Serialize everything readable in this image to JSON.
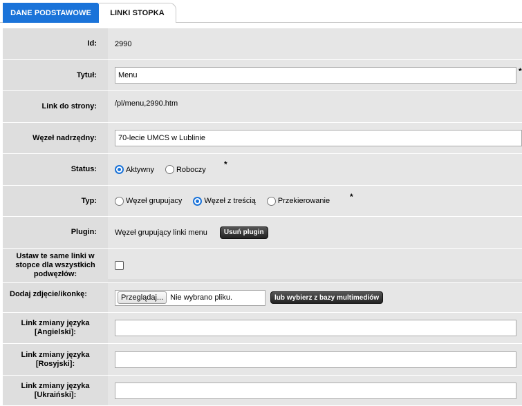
{
  "tabs": {
    "basic": "DANE PODSTAWOWE",
    "footer_links": "LINKI STOPKA"
  },
  "fields": {
    "id": {
      "label": "Id:",
      "value": "2990"
    },
    "title": {
      "label": "Tytuł:",
      "value": "Menu",
      "required": "*"
    },
    "page_link": {
      "label": "Link do strony:",
      "value": "/pl/menu,2990.htm"
    },
    "parent_node": {
      "label": "Węzeł nadrzędny:",
      "value": "70-lecie UMCS w Lublinie"
    },
    "status": {
      "label": "Status:",
      "options": [
        "Aktywny",
        "Roboczy"
      ],
      "selected": "Aktywny",
      "required": "*"
    },
    "type": {
      "label": "Typ:",
      "options": [
        "Węzeł grupujacy",
        "Węzeł z treścią",
        "Przekierowanie"
      ],
      "selected": "Węzeł z treścią",
      "required": "*"
    },
    "plugin": {
      "label": "Plugin:",
      "value": "Węzeł grupujący linki menu",
      "remove_button": "Usuń plugin"
    },
    "same_footer": {
      "label": "Ustaw te same linki w stopce dla wszystkich podwęzłów:",
      "checked": false
    },
    "image": {
      "label": "Dodaj zdjęcie/ikonkę:",
      "browse_button": "Przeglądaj...",
      "file_status": "Nie wybrano pliku.",
      "media_button": "lub wybierz z bazy multimediów"
    },
    "lang_en": {
      "label": "Link zmiany języka [Angielski]:",
      "value": ""
    },
    "lang_ru": {
      "label": "Link zmiany języka [Rosyjski]:",
      "value": ""
    },
    "lang_uk": {
      "label": "Link zmiany języka [Ukraiński]:",
      "value": ""
    }
  },
  "colors": {
    "accent": "#1a73d9",
    "label_bg": "#dedede",
    "value_bg": "#e6e6e6"
  }
}
